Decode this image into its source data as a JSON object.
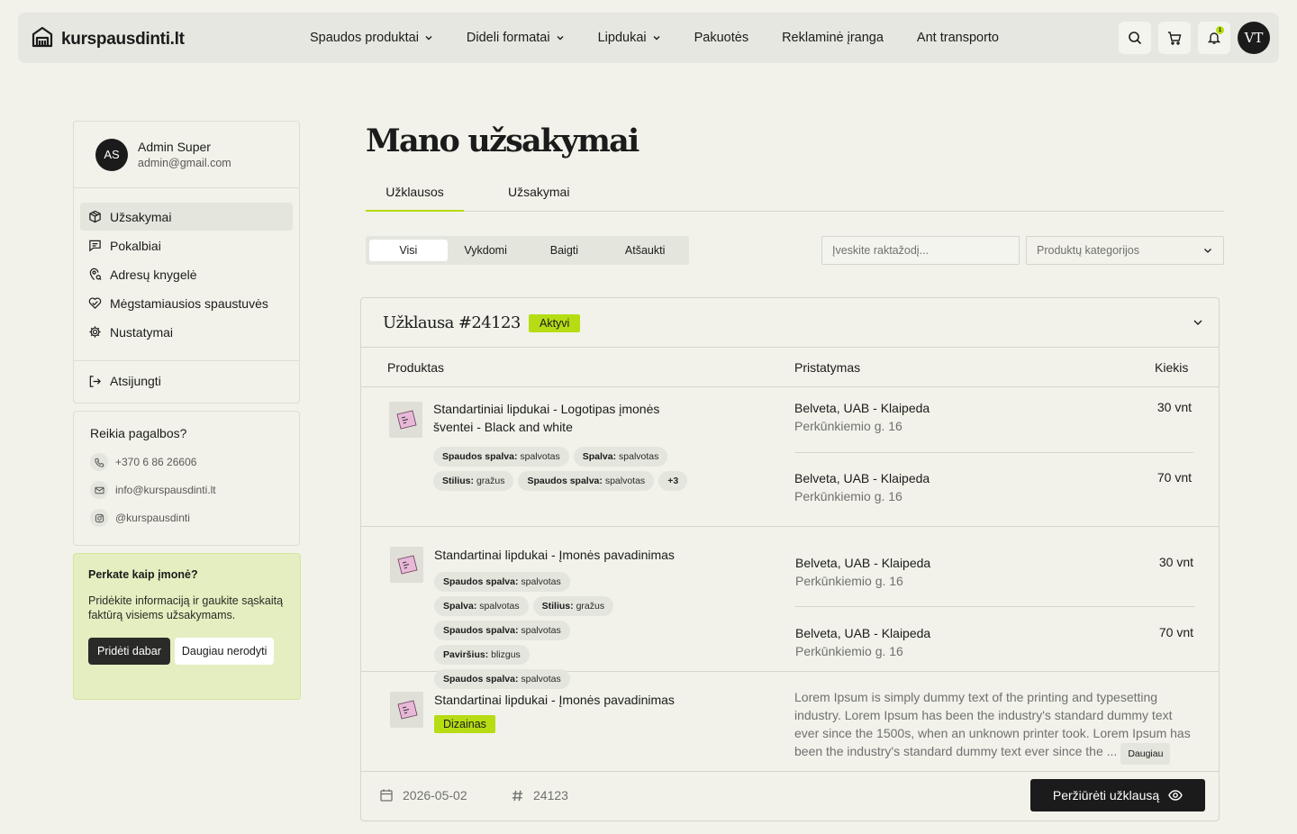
{
  "header": {
    "logo_text": "kurspausdinti.lt",
    "nav": [
      {
        "label": "Spaudos produktai",
        "dropdown": true
      },
      {
        "label": "Dideli formatai",
        "dropdown": true
      },
      {
        "label": "Lipdukai",
        "dropdown": true
      },
      {
        "label": "Pakuotės",
        "dropdown": false
      },
      {
        "label": "Reklaminė įranga",
        "dropdown": false
      },
      {
        "label": "Ant transporto",
        "dropdown": false
      }
    ],
    "notification_count": "1",
    "user_initials": "VT"
  },
  "sidebar": {
    "avatar_initials": "AS",
    "name": "Admin Super",
    "email": "admin@gmail.com",
    "menu": [
      {
        "label": "Užsakymai",
        "icon": "package-icon",
        "active": true
      },
      {
        "label": "Pokalbiai",
        "icon": "chat-icon",
        "active": false
      },
      {
        "label": "Adresų knygelė",
        "icon": "address-book-icon",
        "active": false
      },
      {
        "label": "Mėgstamiausios spaustuvės",
        "icon": "heart-icon",
        "active": false
      },
      {
        "label": "Nustatymai",
        "icon": "gear-icon",
        "active": false
      }
    ],
    "logout_label": "Atsijungti"
  },
  "help": {
    "title": "Reikia pagalbos?",
    "phone": "+370 6 86 26606",
    "email": "info@kurspausdinti.lt",
    "instagram": "@kurspausdinti"
  },
  "company": {
    "title": "Perkate kaip įmonė?",
    "text": "Pridėkite informaciją ir gaukite sąskaitą faktūrą visiems užsakymams.",
    "add_label": "Pridėti dabar",
    "dismiss_label": "Daugiau nerodyti"
  },
  "main": {
    "title": "Mano užsakymai",
    "tabs": [
      "Užklausos",
      "Užsakymai"
    ],
    "filters": [
      "Visi",
      "Vykdomi",
      "Baigti",
      "Atšaukti"
    ],
    "search_placeholder": "Įveskite raktažodį...",
    "category_placeholder": "Produktų kategorijos"
  },
  "order": {
    "title": "Užklausa #24123",
    "status": "Aktyvi",
    "columns": {
      "product": "Produktas",
      "delivery": "Pristatymas",
      "qty": "Kiekis"
    },
    "rows": [
      {
        "name": "Standartiniai lipdukai - Logotipas įmonės šventei - Black and white",
        "tags": [
          {
            "k": "Spaudos spalva:",
            "v": "spalvotas"
          },
          {
            "k": "Spalva:",
            "v": "spalvotas"
          },
          {
            "k": "Stilius:",
            "v": "gražus"
          },
          {
            "k": "Spaudos spalva:",
            "v": "spalvotas"
          }
        ],
        "more": "+3",
        "deliveries": [
          {
            "company": "Belveta, UAB - Klaipeda",
            "address": "Perkūnkiemio g. 16",
            "qty": "30 vnt"
          },
          {
            "company": "Belveta, UAB - Klaipeda",
            "address": "Perkūnkiemio g. 16",
            "qty": "70 vnt"
          }
        ]
      },
      {
        "name": "Standartinai lipdukai - Įmonės pavadinimas",
        "tags": [
          {
            "k": "Spaudos spalva:",
            "v": "spalvotas"
          },
          {
            "k": "Spalva:",
            "v": "spalvotas"
          },
          {
            "k": "Stilius:",
            "v": "gražus"
          },
          {
            "k": "Spaudos spalva:",
            "v": "spalvotas"
          },
          {
            "k": "Paviršius:",
            "v": "blizgus"
          },
          {
            "k": "Spaudos spalva:",
            "v": "spalvotas"
          }
        ],
        "deliveries": [
          {
            "company": "Belveta, UAB - Klaipeda",
            "address": "Perkūnkiemio g. 16",
            "qty": "30 vnt"
          },
          {
            "company": "Belveta, UAB - Klaipeda",
            "address": "Perkūnkiemio g. 16",
            "qty": "70 vnt"
          }
        ]
      },
      {
        "name": "Standartinai lipdukai - Įmonės pavadinimas",
        "badge": "Dizainas",
        "description": "Lorem Ipsum is simply dummy text of the printing and typesetting industry. Lorem Ipsum has been the industry's standard dummy text ever since the 1500s, when an unknown printer took. Lorem Ipsum has been the industry's standard dummy text ever since the ...",
        "more_label": "Daugiau"
      }
    ],
    "date": "2026-05-02",
    "number": "24123",
    "view_label": "Peržiūrėti užklausą"
  }
}
